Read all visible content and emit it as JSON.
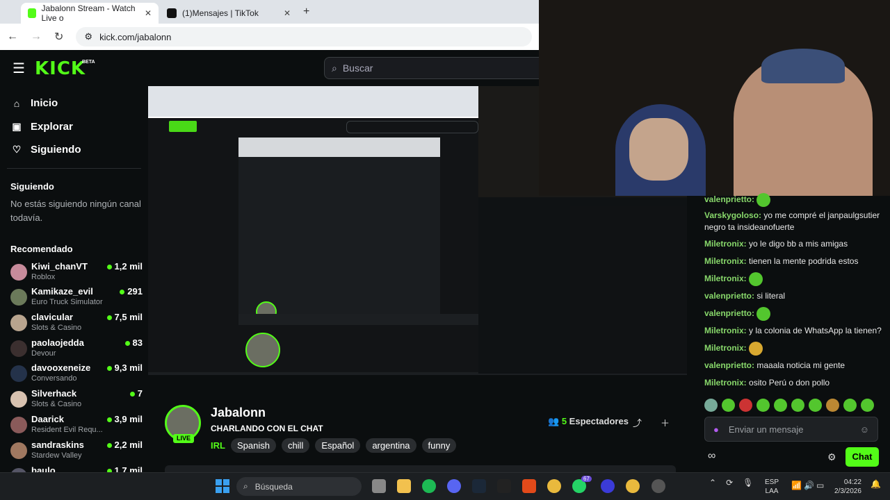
{
  "browser": {
    "tabs": [
      {
        "title": "Jabalonn Stream - Watch Live o",
        "active": true
      },
      {
        "title": "(1)Mensajes | TikTok",
        "active": false
      }
    ],
    "url": "kick.com/jabalonn"
  },
  "kick": {
    "logo": "KICK",
    "beta": "BETA",
    "search_placeholder": "Buscar",
    "nav": [
      "Inicio",
      "Explorar",
      "Siguiendo"
    ],
    "following_heading": "Siguiendo",
    "following_empty": "No estás siguiendo ningún canal todavía.",
    "recommended_heading": "Recomendado",
    "recommended": [
      {
        "name": "Kiwi_chanVT",
        "category": "Roblox",
        "viewers": "1,2 mil"
      },
      {
        "name": "Kamikaze_evil",
        "category": "Euro Truck Simulator",
        "viewers": "291"
      },
      {
        "name": "clavicular",
        "category": "Slots & Casino",
        "viewers": "7,5 mil"
      },
      {
        "name": "paolaojedda",
        "category": "Devour",
        "viewers": "83"
      },
      {
        "name": "davooxeneize",
        "category": "Conversando",
        "viewers": "9,3 mil"
      },
      {
        "name": "Silverhack",
        "category": "Slots & Casino",
        "viewers": "7"
      },
      {
        "name": "Daarick",
        "category": "Resident Evil Requ...",
        "viewers": "3,9 mil"
      },
      {
        "name": "sandraskins",
        "category": "Stardew Valley",
        "viewers": "2,2 mil"
      },
      {
        "name": "baulo",
        "category": "",
        "viewers": "1,7 mil"
      }
    ]
  },
  "stream": {
    "name": "Jabalonn",
    "live": "LIVE",
    "title": "CHARLANDO CON EL CHAT",
    "category": "IRL",
    "tags": [
      "Spanish",
      "chill",
      "Español",
      "argentina",
      "funny"
    ],
    "viewers_count": "5",
    "viewers_label": "Espectadores"
  },
  "chat": {
    "messages": [
      {
        "user": "valenprietto:",
        "text": "",
        "emote": true
      },
      {
        "user": "Varskygoloso:",
        "text": "yo me compré el janpaulgsutier negro ta insideanofuerte",
        "emote": false
      },
      {
        "user": "Miletronix:",
        "text": "yo le digo bb a mis amigas",
        "emote": false
      },
      {
        "user": "Miletronix:",
        "text": "tienen la mente podrida estos",
        "emote": false
      },
      {
        "user": "Miletronix:",
        "text": "",
        "emote": true
      },
      {
        "user": "valenprietto:",
        "text": "si literal",
        "emote": false
      },
      {
        "user": "valenprietto:",
        "text": "",
        "emote": true
      },
      {
        "user": "Miletronix:",
        "text": "y la colonia de WhatsApp la tienen?",
        "emote": false
      },
      {
        "user": "Miletronix:",
        "text": "",
        "emote": true
      },
      {
        "user": "valenprietto:",
        "text": "maaala noticia mi gente",
        "emote": false
      },
      {
        "user": "Miletronix:",
        "text": "osito Perú o don pollo",
        "emote": false
      }
    ],
    "input_placeholder": "Enviar un mensaje",
    "send_label": "Chat"
  },
  "taskbar": {
    "search_label": "Búsqueda",
    "lang_top": "ESP",
    "lang_bottom": "LAA",
    "time": "04:22",
    "date": "2/3/2026",
    "whatsapp_badge": "67"
  }
}
